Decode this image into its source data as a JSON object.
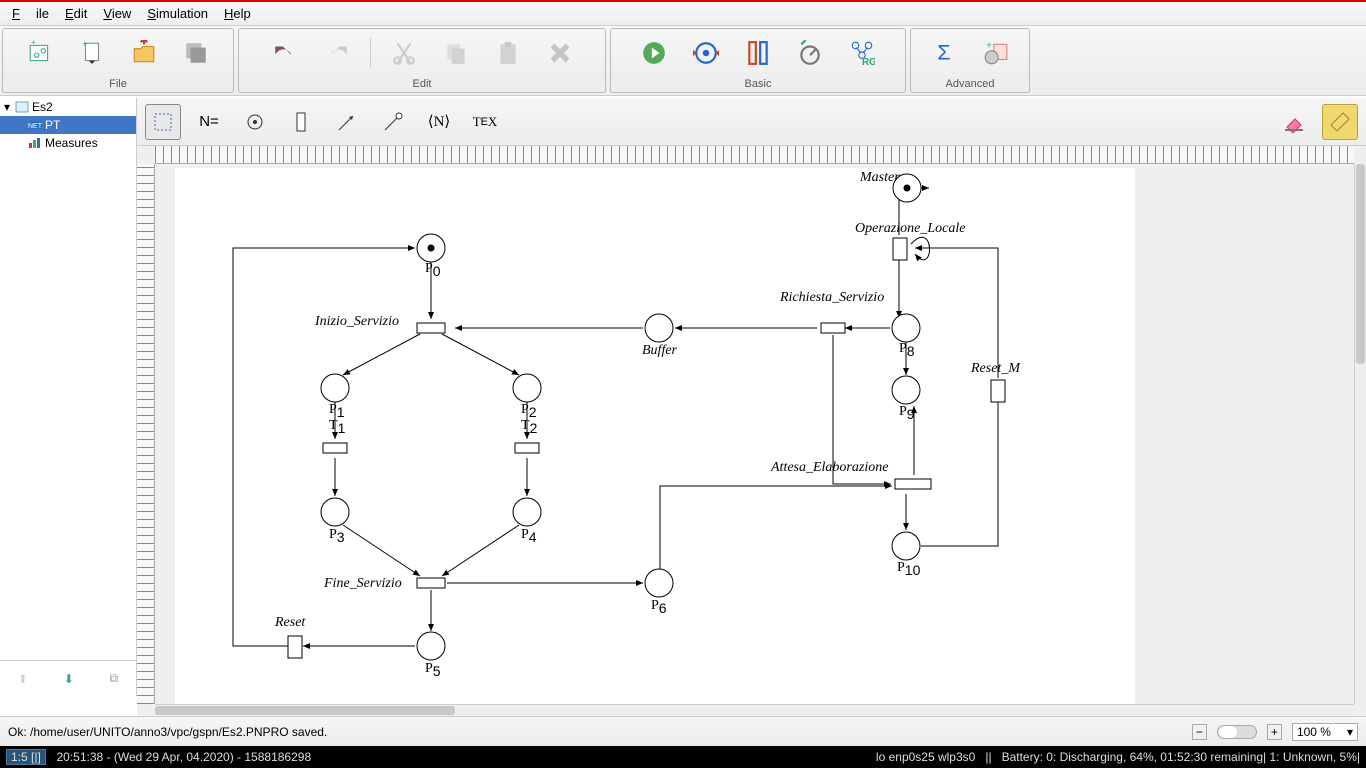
{
  "menu": {
    "file": "File",
    "edit": "Edit",
    "view": "View",
    "simulation": "Simulation",
    "help": "Help"
  },
  "toolbar_groups": {
    "file": "File",
    "edit": "Edit",
    "basic": "Basic",
    "advanced": "Advanced"
  },
  "tree": {
    "root": "Es2",
    "pt": "PT",
    "measures": "Measures"
  },
  "secondary": {
    "neq": "N=",
    "angle": "⟨N⟩",
    "tex": "TEX"
  },
  "status": {
    "msg": "Ok: /home/user/UNITO/anno3/vpc/gspn/Es2.PNPRO saved.",
    "zoom": "100 %"
  },
  "i3": {
    "ws": "1:5 [|]",
    "time": "  20:51:38 - (Wed 29 Apr, 04.2020) - 1588186298",
    "net": "lo enp0s25 wlp3s0   ||   Battery: 0: Discharging, 64%, 01:52:30 remaining| 1: Unknown, 5%|"
  },
  "net_labels": {
    "master": "Master",
    "oploc": "Operazione_Locale",
    "richserv": "Richiesta_Servizio",
    "iniserv": "Inizio_Servizio",
    "buffer": "Buffer",
    "attesa": "Attesa_Elaborazione",
    "fineserv": "Fine_Servizio",
    "reset": "Reset",
    "resetm": "Reset_M",
    "p0": "P",
    "p1": "P",
    "p2": "P",
    "p3": "P",
    "p4": "P",
    "p5": "P",
    "p6": "P",
    "p8": "P",
    "p9": "P",
    "p10": "P",
    "t1": "T",
    "t2": "T"
  }
}
